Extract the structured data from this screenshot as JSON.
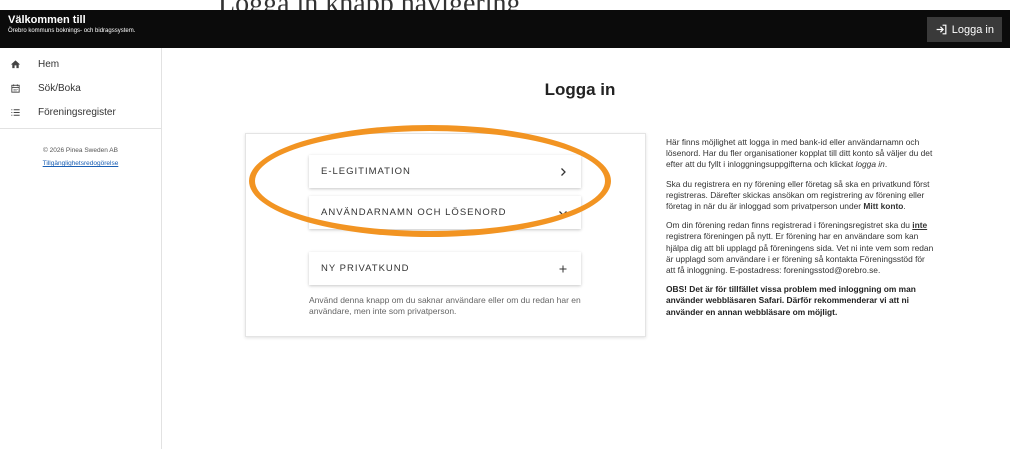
{
  "annotation": {
    "text": "Logga in knapp navigering"
  },
  "header": {
    "title": "Välkommen till",
    "subtitle": "Örebro kommuns boknings- och bidragssystem.",
    "login_label": "Logga in"
  },
  "sidebar": {
    "items": [
      {
        "label": "Hem",
        "icon": "home-icon"
      },
      {
        "label": "Sök/Boka",
        "icon": "calendar-icon"
      },
      {
        "label": "Föreningsregister",
        "icon": "list-icon"
      }
    ],
    "copyright": "© 2026 Pinea Sweden AB",
    "accessibility_link": "Tillgänglighetsredogörelse"
  },
  "main": {
    "title": "Logga in",
    "options": [
      {
        "label": "E-LEGITIMATION",
        "icon": "chevron-right-icon"
      },
      {
        "label": "ANVÄNDARNAMN OCH LÖSENORD",
        "icon": "chevron-down-icon"
      },
      {
        "label": "NY PRIVATKUND",
        "icon": "plus-icon"
      }
    ],
    "help_text": "Använd denna knapp om du saknar användare eller om du redan har en användare, men inte som privatperson."
  },
  "info": {
    "p1_a": "Här finns möjlighet att logga in med bank-id eller användarnamn och lösenord. Har du fler organisationer kopplat till ditt konto så väljer du det efter att du fyllt i inloggningsuppgifterna och klickat ",
    "p1_em": "logga in",
    "p1_b": ".",
    "p2_a": "Ska du registrera en ny förening eller företag så ska en privatkund först registreras. Därefter skickas ansökan om registrering av förening eller företag in när du är inloggad som privatperson under ",
    "p2_strong": "Mitt konto",
    "p2_b": ".",
    "p3_a": "Om din förening redan finns registrerad i föreningsregistret ska du ",
    "p3_strong": "inte",
    "p3_b": " registrera föreningen på nytt. Er förening har en användare som kan hjälpa dig att bli upplagd på föreningens sida. Vet ni inte vem som redan är upplagd som användare i er förening så kontakta Föreningsstöd för att få inloggning. E-postadress: foreningsstod@orebro.se.",
    "p4": "OBS! Det är för tillfället vissa problem med inloggning om man använder webbläsaren Safari. Därför rekommenderar vi att ni använder en annan webbläsare om möjligt."
  },
  "colors": {
    "highlight": "#f29422",
    "topbar": "#0b0b0b",
    "link": "#1a5fb4"
  }
}
